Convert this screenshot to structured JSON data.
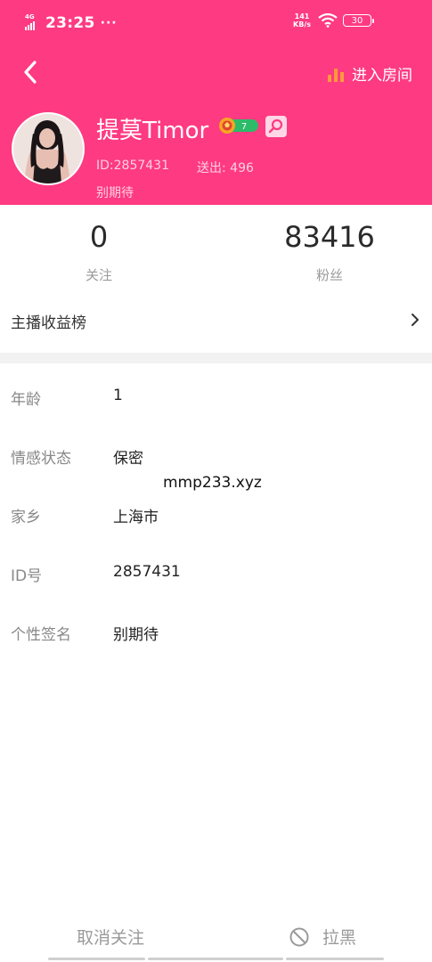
{
  "status_bar": {
    "network": "4G",
    "time": "23:25",
    "more": "···",
    "speed_value": "141",
    "speed_unit": "KB/s",
    "battery": "30"
  },
  "header": {
    "back_icon": "chevron-left-icon",
    "enter_room_label": "进入房间",
    "room_icon": "bar-chart-icon",
    "nickname": "提莫Timor",
    "level": "7",
    "user_id": "ID:2857431",
    "sent": "送出: 496",
    "bio": "别期待",
    "background_color": "#fe3a82"
  },
  "stats": {
    "following_count": "0",
    "following_label": "关注",
    "fans_count": "83416",
    "fans_label": "粉丝"
  },
  "rank": {
    "label": "主播收益榜"
  },
  "info": [
    {
      "key": "年龄",
      "value": "1"
    },
    {
      "key": "情感状态",
      "value": "保密"
    },
    {
      "key": "家乡",
      "value": "上海市"
    },
    {
      "key": "ID号",
      "value": "2857431"
    },
    {
      "key": "个性签名",
      "value": "别期待"
    }
  ],
  "watermark": "mmp233.xyz",
  "bottom": {
    "unfollow_label": "取消关注",
    "block_label": "拉黑"
  }
}
